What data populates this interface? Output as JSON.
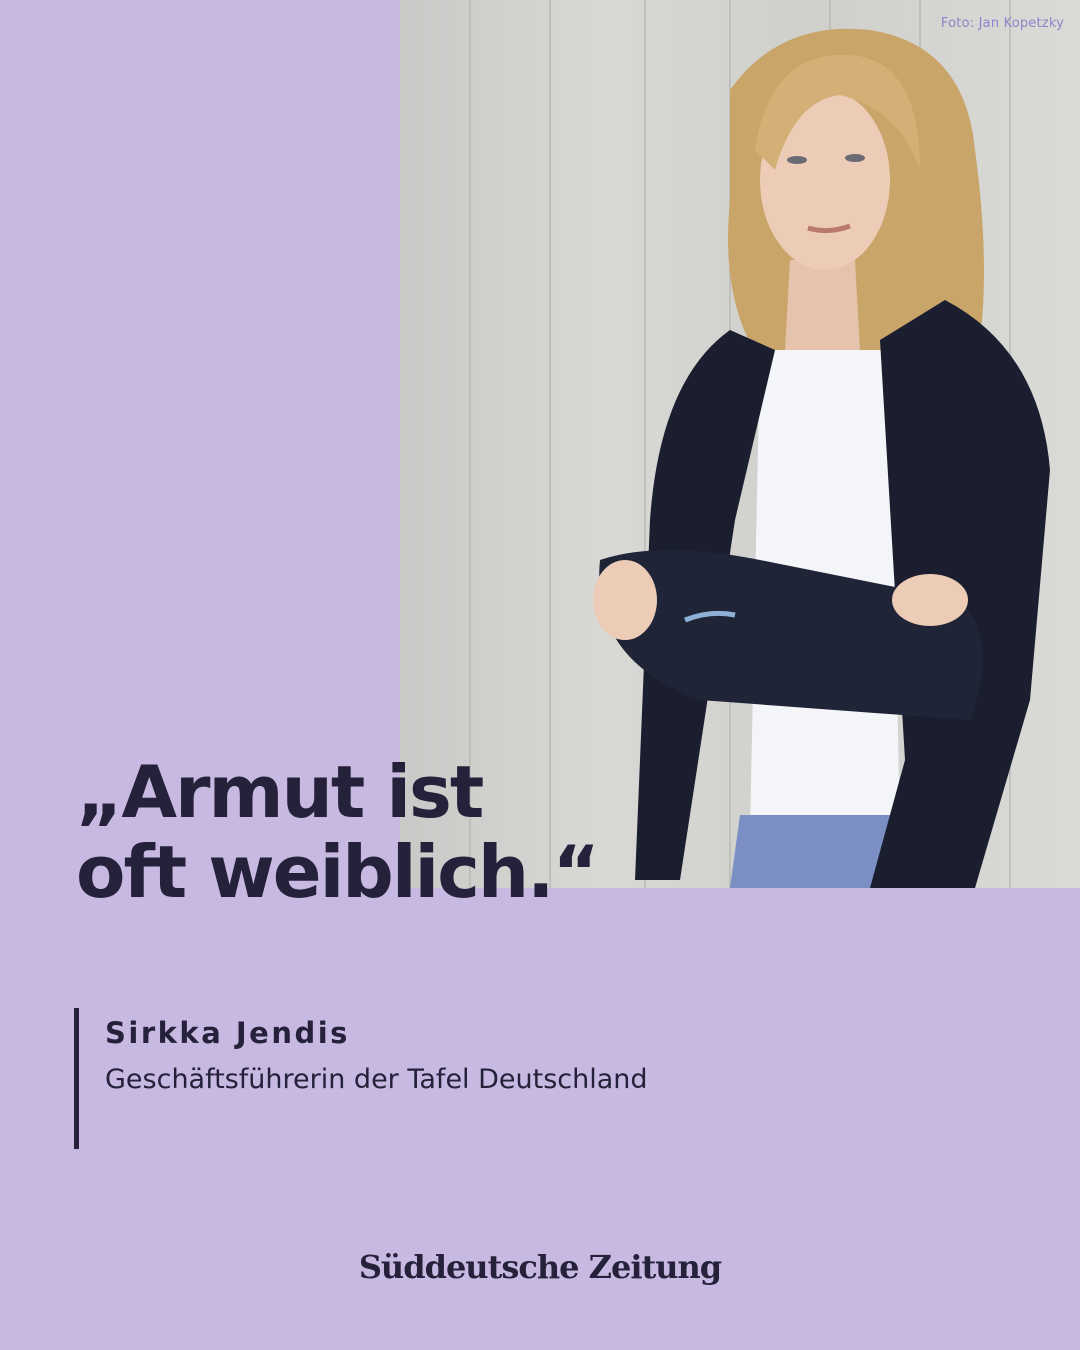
{
  "photo": {
    "credit": "Foto: Jan Kopetzky",
    "subject_description": "Portrait of a woman with blonde hair in a dark blazer and white t-shirt, arms crossed, leaning against a concrete wall"
  },
  "quote": {
    "line1": "„Armut ist",
    "line2": "oft weiblich.“"
  },
  "attribution": {
    "name": "Sirkka Jendis",
    "role": "Geschäftsführerin der Tafel Deutschland"
  },
  "brand": {
    "logo_text": "Süddeutsche Zeitung"
  },
  "colors": {
    "background": "#c7b9e1",
    "text": "#25213a",
    "credit": "#8e84c9"
  }
}
